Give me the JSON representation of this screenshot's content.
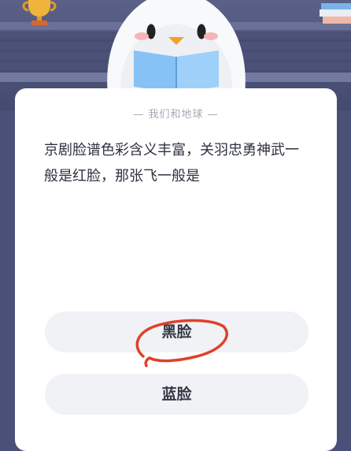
{
  "card": {
    "subtitle": "— 我们和地球 —",
    "question": "京剧脸谱色彩含义丰富，关羽忠勇神武一般是红脸，那张飞一般是"
  },
  "options": [
    {
      "label": "黑脸"
    },
    {
      "label": "蓝脸"
    }
  ],
  "colors": {
    "background": "#4a5078",
    "card": "#ffffff",
    "option_bg": "#f0f2f5",
    "annotation": "#e0402a",
    "book": "#7fb8f0"
  }
}
